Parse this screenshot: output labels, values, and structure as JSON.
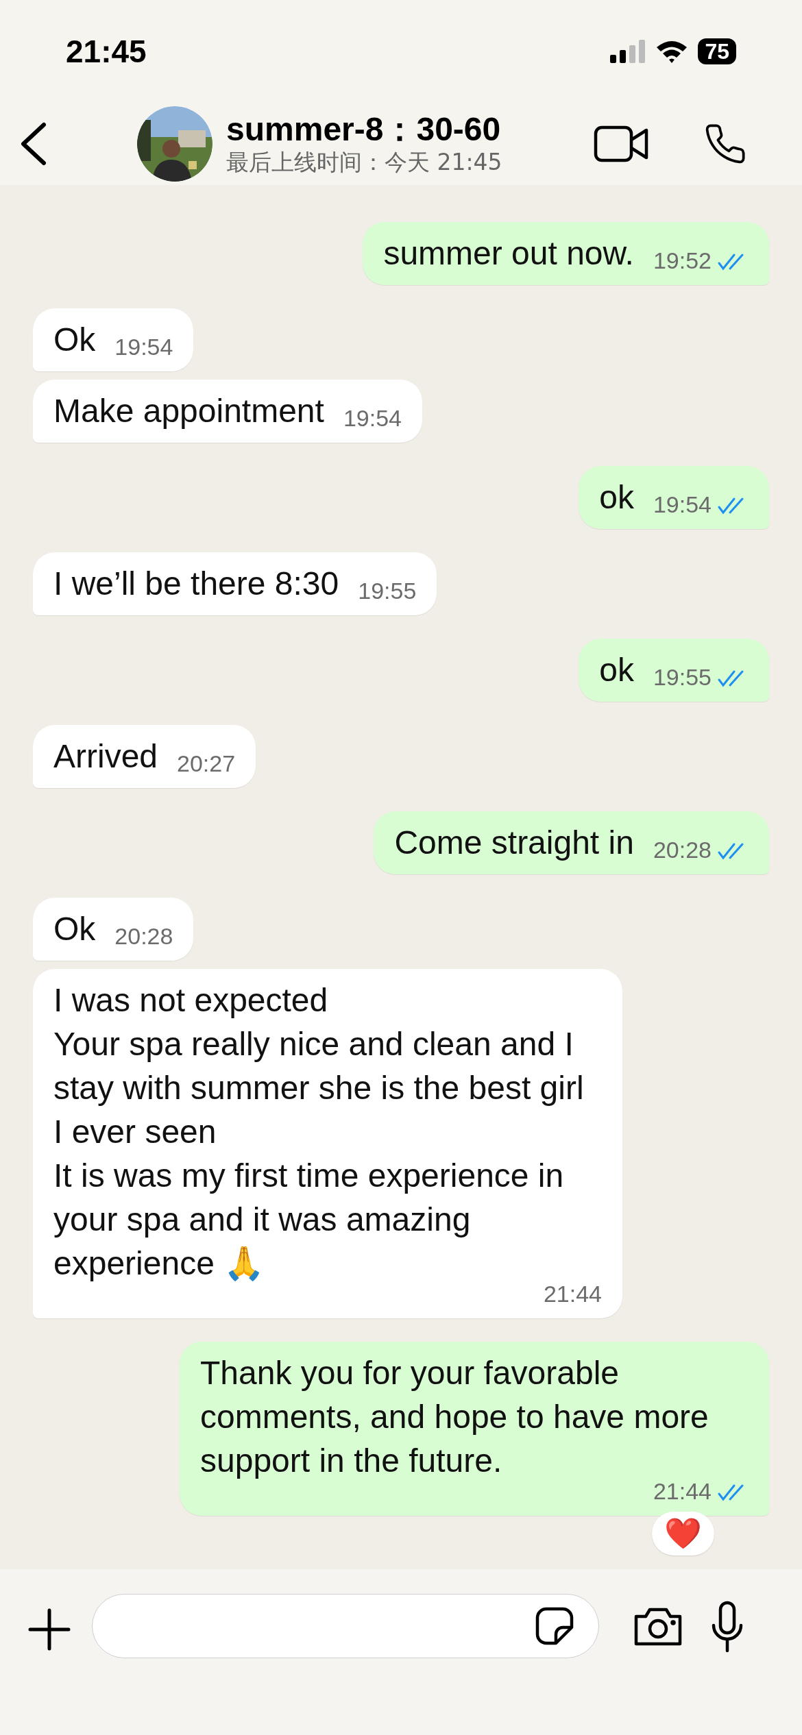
{
  "status_bar": {
    "time": "21:45",
    "battery": "75"
  },
  "header": {
    "name": "summer-8：30-60",
    "last_seen": "最后上线时间：今天 21:45"
  },
  "messages": [
    {
      "kind": "outgoing",
      "text": "summer out now.",
      "time": "19:52",
      "read": true
    },
    {
      "kind": "incoming",
      "text": "Ok",
      "time": "19:54"
    },
    {
      "kind": "incoming",
      "text": "Make appointment",
      "time": "19:54"
    },
    {
      "kind": "outgoing",
      "text": "ok",
      "time": "19:54",
      "read": true
    },
    {
      "kind": "incoming",
      "text": "I we’ll be there 8:30",
      "time": "19:55"
    },
    {
      "kind": "outgoing",
      "text": "ok",
      "time": "19:55",
      "read": true
    },
    {
      "kind": "incoming",
      "text": "Arrived",
      "time": "20:27"
    },
    {
      "kind": "outgoing",
      "text": "Come straight in",
      "time": "20:28",
      "read": true
    },
    {
      "kind": "incoming",
      "text": "Ok",
      "time": "20:28"
    },
    {
      "kind": "incoming",
      "text": "I was not expected\nYour spa really nice and clean and I stay with summer she is the best girl I ever seen\nIt is was my first time experience in your spa and it was amazing experience 🙏",
      "time": "21:44"
    },
    {
      "kind": "outgoing",
      "text": "Thank you for your favorable comments, and hope to have more support in the future.",
      "time": "21:44",
      "read": true,
      "reaction": "❤️"
    }
  ]
}
